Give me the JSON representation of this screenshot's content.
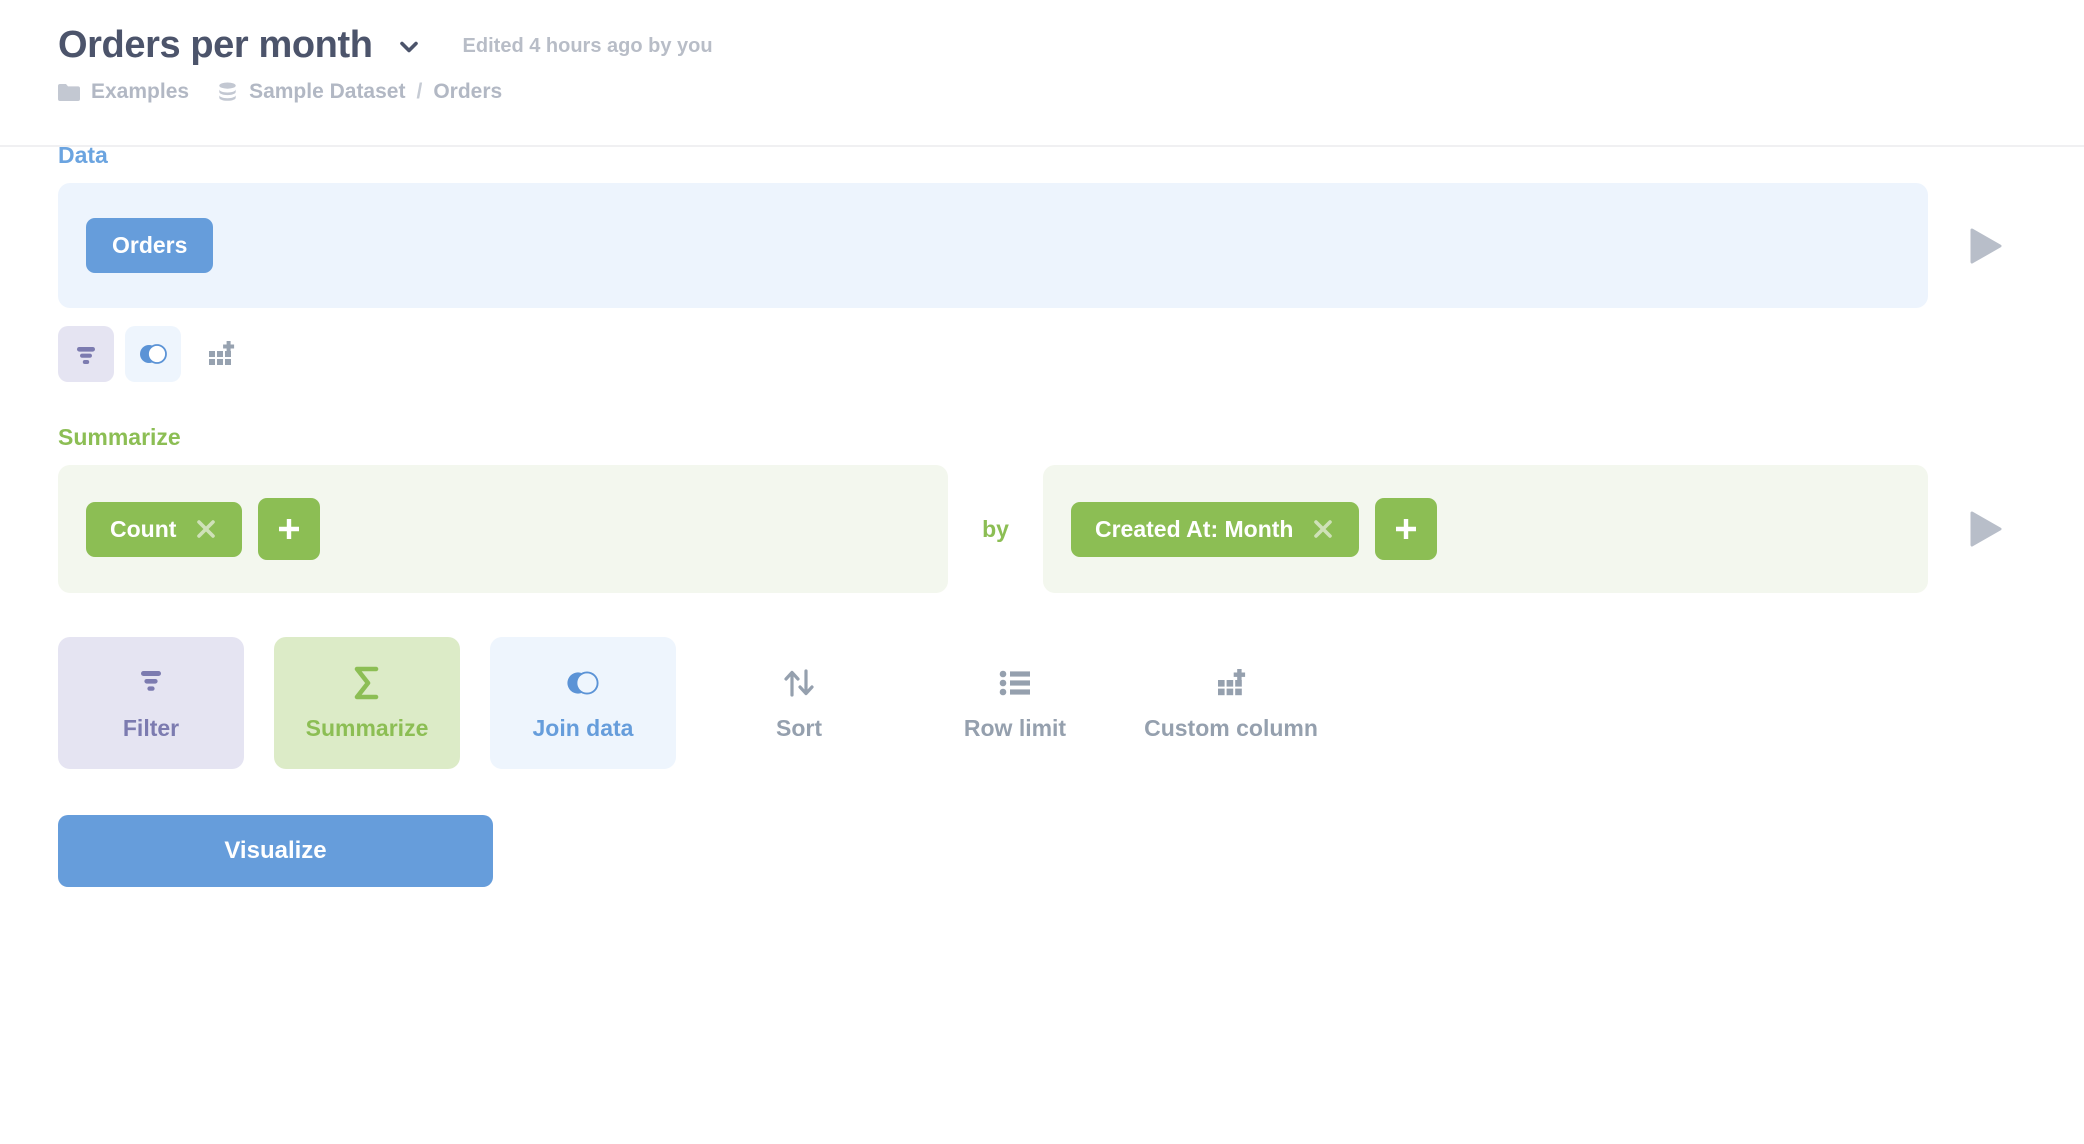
{
  "header": {
    "title": "Orders per month",
    "title_chevron_icon": "chevron-down-icon",
    "edited_note": "Edited 4 hours ago by you",
    "breadcrumb": {
      "collection_icon": "folder-icon",
      "collection": "Examples",
      "database_icon": "database-icon",
      "database": "Sample Dataset",
      "separator": "/",
      "table": "Orders"
    }
  },
  "data_step": {
    "label": "Data",
    "source_chip": "Orders",
    "preview_icon": "play-triangle-icon",
    "mini_actions": [
      {
        "name": "filter",
        "icon": "filter-funnel-icon"
      },
      {
        "name": "join",
        "icon": "venn-join-icon"
      },
      {
        "name": "custom-column",
        "icon": "grid-plus-icon"
      }
    ]
  },
  "summarize_step": {
    "label": "Summarize",
    "aggregation_chip": "Count",
    "aggregation_remove_icon": "close-x-icon",
    "add_aggregation_icon": "plus-icon",
    "by_word": "by",
    "breakout_chip": "Created At: Month",
    "breakout_remove_icon": "close-x-icon",
    "add_breakout_icon": "plus-icon",
    "preview_icon": "play-triangle-icon"
  },
  "actions": [
    {
      "label": "Filter",
      "icon": "filter-funnel-icon",
      "style": "tile-filter"
    },
    {
      "label": "Summarize",
      "icon": "sigma-icon",
      "style": "tile-summarize"
    },
    {
      "label": "Join data",
      "icon": "venn-join-icon",
      "style": "tile-join"
    },
    {
      "label": "Sort",
      "icon": "sort-arrows-icon",
      "style": "tile-plain"
    },
    {
      "label": "Row limit",
      "icon": "list-icon",
      "style": "tile-plain"
    },
    {
      "label": "Custom column",
      "icon": "grid-plus-icon",
      "style": "tile-plain"
    }
  ],
  "visualize": {
    "label": "Visualize"
  },
  "colors": {
    "brand_blue": "#669ddb",
    "summarize_green": "#8cbe54",
    "filter_purple": "#7c7bb0",
    "text_dark": "#4c546b",
    "text_muted": "#b2b8c4",
    "panel_blue_bg": "#edf4fd",
    "panel_green_bg": "#f3f7ee"
  }
}
